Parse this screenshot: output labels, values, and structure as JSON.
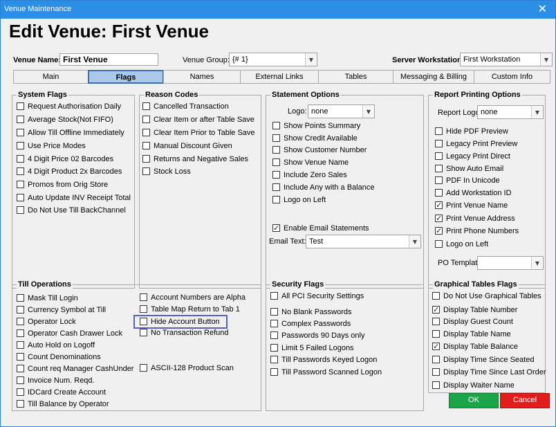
{
  "window": {
    "title": "Venue Maintenance",
    "close_glyph": "✕",
    "close_icon": "close-icon"
  },
  "heading": "Edit Venue: First Venue",
  "header": {
    "venue_name_label": "Venue Name:",
    "venue_name_value": "First Venue",
    "venue_group_label": "Venue Group:",
    "venue_group_value": "{# 1}",
    "server_ws_label": "Server Workstation:",
    "server_ws_value": "First Workstation"
  },
  "tabs": [
    "Main",
    "Flags",
    "Names",
    "External Links",
    "Tables",
    "Messaging & Billing",
    "Custom Info"
  ],
  "active_tab": "Flags",
  "system_flags": {
    "title": "System Flags",
    "items": [
      {
        "label": "Request Authorisation Daily",
        "checked": false
      },
      {
        "label": "Average Stock(Not FIFO)",
        "checked": false
      },
      {
        "label": "Allow Till Offline Immediately",
        "checked": false
      },
      {
        "label": "Use Price Modes",
        "checked": false
      },
      {
        "label": "4 Digit Price 02 Barcodes",
        "checked": false
      },
      {
        "label": "4 Digit Product 2x Barcodes",
        "checked": false
      },
      {
        "label": "Promos from Orig Store",
        "checked": false
      },
      {
        "label": "Auto Update INV Receipt Total",
        "checked": false
      },
      {
        "label": "Do Not Use Till BackChannel",
        "checked": false
      }
    ]
  },
  "reason_codes": {
    "title": "Reason Codes",
    "items": [
      {
        "label": "Cancelled Transaction",
        "checked": false
      },
      {
        "label": "Clear Item or after Table Save",
        "checked": false
      },
      {
        "label": "Clear Item Prior to Table Save",
        "checked": false
      },
      {
        "label": "Manual Discount Given",
        "checked": false
      },
      {
        "label": "Returns and Negative Sales",
        "checked": false
      },
      {
        "label": "Stock Loss",
        "checked": false
      }
    ]
  },
  "statement_options": {
    "title": "Statement Options",
    "logo_label": "Logo:",
    "logo_value": "none",
    "items": [
      {
        "label": "Show Points Summary",
        "checked": false
      },
      {
        "label": "Show Credit Available",
        "checked": false
      },
      {
        "label": "Show Customer Number",
        "checked": false
      },
      {
        "label": "Show Venue Name",
        "checked": false
      },
      {
        "label": "Include Zero Sales",
        "checked": false
      },
      {
        "label": "Include Any with a Balance",
        "checked": false
      },
      {
        "label": "Logo on Left",
        "checked": false
      }
    ],
    "enable_email": {
      "label": "Enable Email Statements",
      "checked": true
    },
    "email_text_label": "Email Text:",
    "email_text_value": "Test"
  },
  "report_printing": {
    "title": "Report Printing Options",
    "logo_label": "Report Logo:",
    "logo_value": "none",
    "items": [
      {
        "label": "Hide PDF Preview",
        "checked": false
      },
      {
        "label": "Legacy Print Preview",
        "checked": false
      },
      {
        "label": "Legacy Print Direct",
        "checked": false
      },
      {
        "label": "Show Auto Email",
        "checked": false
      },
      {
        "label": "PDF In Unicode",
        "checked": false
      },
      {
        "label": "Add Workstation ID",
        "checked": false
      },
      {
        "label": "Print Venue Name",
        "checked": true
      },
      {
        "label": "Print Venue Address",
        "checked": true
      },
      {
        "label": "Print Phone Numbers",
        "checked": true
      },
      {
        "label": "Logo on Left",
        "checked": false
      }
    ],
    "po_template_label": "PO Template:",
    "po_template_value": ""
  },
  "till_operations": {
    "title": "Till Operations",
    "left_items": [
      {
        "label": "Mask Till Login",
        "checked": false
      },
      {
        "label": "Currency Symbol at Till",
        "checked": false
      },
      {
        "label": "Operator Lock",
        "checked": false
      },
      {
        "label": "Operator Cash Drawer Lock",
        "checked": false
      },
      {
        "label": "Auto Hold on Logoff",
        "checked": false
      },
      {
        "label": "Count Denominations",
        "checked": false
      },
      {
        "label": "Count req Manager CashUnder",
        "checked": false
      },
      {
        "label": "Invoice Num. Reqd.",
        "checked": false
      },
      {
        "label": "IDCard Create Account",
        "checked": false
      },
      {
        "label": "Till Balance by Operator",
        "checked": false
      }
    ],
    "right_items": [
      {
        "label": "Account Numbers are Alpha",
        "checked": false
      },
      {
        "label": "Table Map Return to Tab 1",
        "checked": false
      },
      {
        "label": "Hide Account Button",
        "checked": false
      },
      {
        "label": "No Transaction Refund",
        "checked": false
      }
    ],
    "ascii_item": {
      "label": "ASCII-128 Product Scan",
      "checked": false
    }
  },
  "security_flags": {
    "title": "Security Flags",
    "all_pci": {
      "label": "All PCI Security Settings",
      "checked": false
    },
    "items": [
      {
        "label": "No Blank Passwords",
        "checked": false
      },
      {
        "label": "Complex Passwords",
        "checked": false
      },
      {
        "label": "Passwords 90 Days only",
        "checked": false
      },
      {
        "label": "Limit 5 Failed Logons",
        "checked": false
      },
      {
        "label": "Till Passwords Keyed Logon",
        "checked": false
      },
      {
        "label": "Till Password Scanned Logon",
        "checked": false
      }
    ]
  },
  "graphical_tables": {
    "title": "Graphical Tables Flags",
    "items": [
      {
        "label": "Do Not Use Graphical Tables",
        "checked": false
      },
      {
        "label": "Display Table Number",
        "checked": true
      },
      {
        "label": "Display Guest Count",
        "checked": false
      },
      {
        "label": "Display Table Name",
        "checked": false
      },
      {
        "label": "Display Table Balance",
        "checked": true
      },
      {
        "label": "Display Time Since Seated",
        "checked": false
      },
      {
        "label": "Display Time Since Last Order",
        "checked": false
      },
      {
        "label": "Display Waiter Name",
        "checked": false
      }
    ]
  },
  "buttons": {
    "ok": "OK",
    "cancel": "Cancel"
  },
  "colors": {
    "titlebar": "#2b8fe6",
    "active_tab": "#a9c8ea",
    "ok": "#1aa548",
    "cancel": "#e31c1c",
    "highlight": "#5660c4"
  },
  "icons": {
    "dropdown": "chevron-down-icon",
    "check": "checkmark-icon"
  }
}
